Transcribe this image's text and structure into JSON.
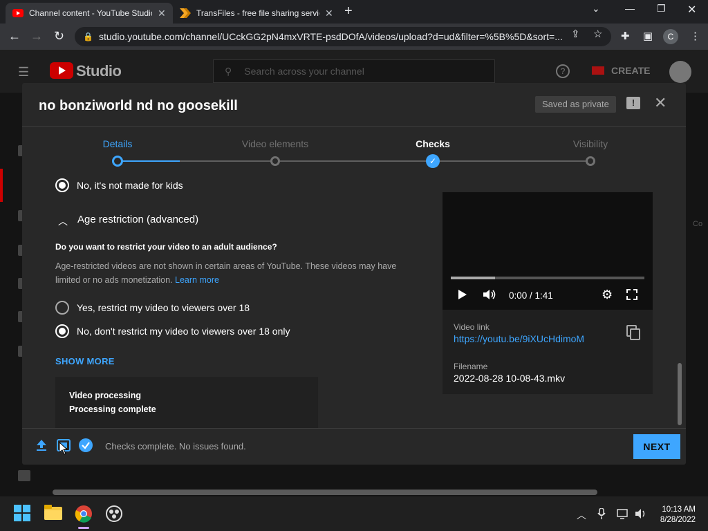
{
  "browser": {
    "tabs": [
      {
        "title": "Channel content - YouTube Studio",
        "close": "✕",
        "favicon": "youtube-icon"
      },
      {
        "title": "TransFiles - free file sharing service",
        "close": "✕",
        "favicon": "transfiles-icon"
      }
    ],
    "new_tab": "+",
    "url": "studio.youtube.com/channel/UCckGG2pN4mxVRTE-psdDOfA/videos/upload?d=ud&filter=%5B%5D&sort=...",
    "profile_initial": "C"
  },
  "studio": {
    "logo_text": "Studio",
    "search_placeholder": "Search across your channel",
    "create_label": "CREATE",
    "right_faint": "Co"
  },
  "dialog": {
    "title": "no bonziworld nd no goosekill",
    "saved_badge": "Saved as private",
    "steps": [
      {
        "label": "Details",
        "state": "active"
      },
      {
        "label": "Video elements",
        "state": "pending"
      },
      {
        "label": "Checks",
        "state": "current"
      },
      {
        "label": "Visibility",
        "state": "pending"
      }
    ],
    "kids_option": "No, it's not made for kids",
    "age_section": "Age restriction (advanced)",
    "age_question": "Do you want to restrict your video to an adult audience?",
    "age_desc": "Age-restricted videos are not shown in certain areas of YouTube. These videos may have limited or no ads monetization.",
    "learn_more": "Learn more",
    "option_yes": "Yes, restrict my video to viewers over 18",
    "option_no": "No, don't restrict my video to viewers over 18 only",
    "show_more": "SHOW MORE",
    "processing_title": "Video processing",
    "processing_status": "Processing complete",
    "video": {
      "time": "0:00 / 1:41",
      "progress_fraction": 0.23,
      "link_label": "Video link",
      "link": "https://youtu.be/9iXUcHdimoM",
      "filename_label": "Filename",
      "filename": "2022-08-28 10-08-43.mkv"
    },
    "footer_message": "Checks complete. No issues found.",
    "next_label": "NEXT"
  },
  "taskbar": {
    "time": "10:13 AM",
    "date": "8/28/2022"
  },
  "colors": {
    "accent": "#3ea6ff",
    "brand_red": "#cc0000",
    "dialog_bg": "#282828"
  }
}
